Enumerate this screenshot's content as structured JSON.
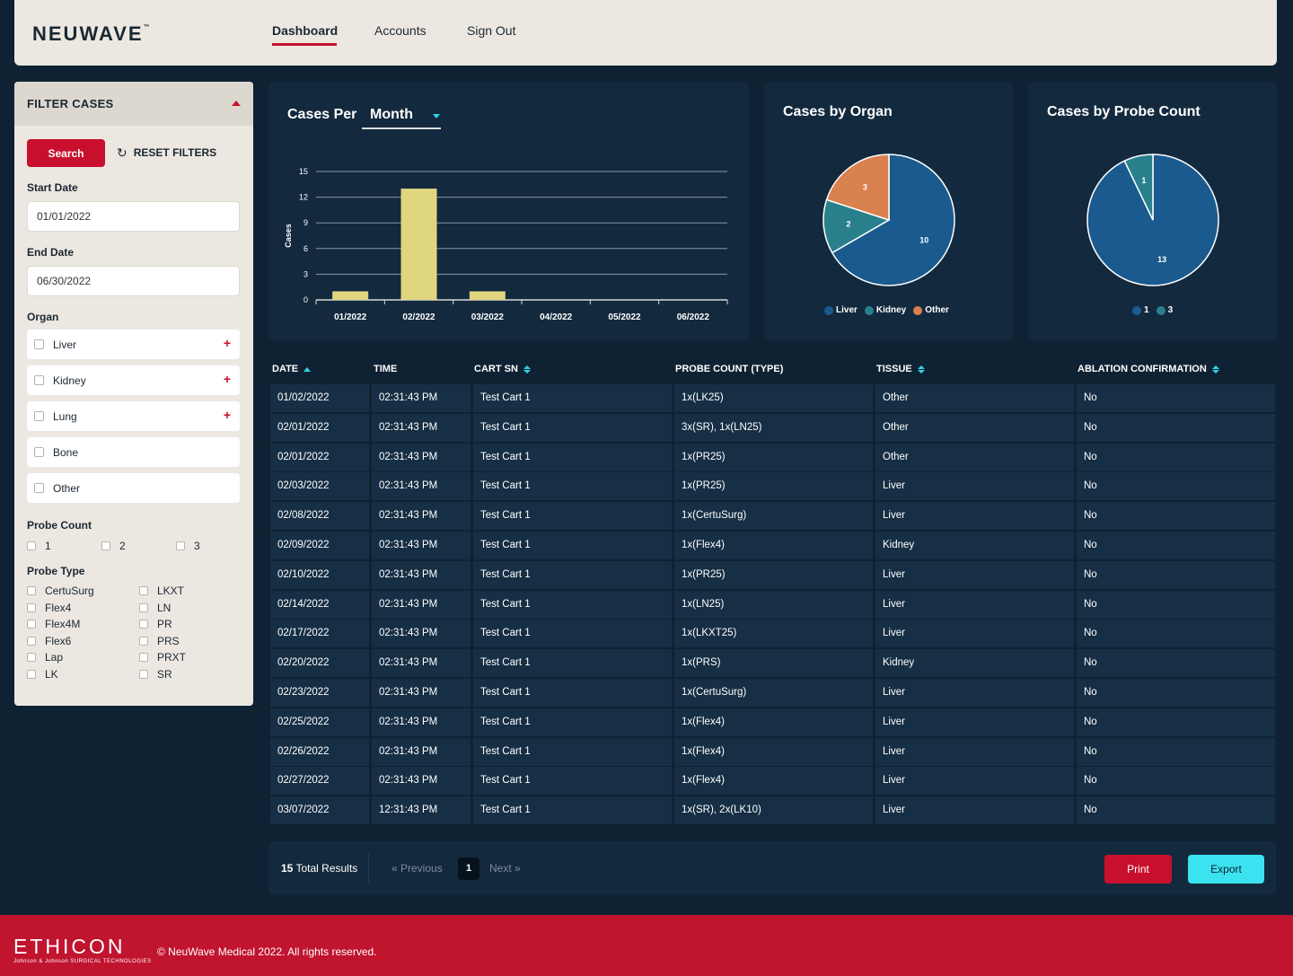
{
  "header": {
    "logo": "NEUWAVE",
    "logo_mark": "™",
    "nav": [
      "Dashboard",
      "Accounts",
      "Sign Out"
    ]
  },
  "sidebar": {
    "title": "FILTER CASES",
    "search_label": "Search",
    "reset_label": "RESET FILTERS",
    "start_date_label": "Start Date",
    "start_date_value": "01/01/2022",
    "end_date_label": "End Date",
    "end_date_value": "06/30/2022",
    "organ_label": "Organ",
    "organs": [
      "Liver",
      "Kidney",
      "Lung",
      "Bone",
      "Other"
    ],
    "probe_count_label": "Probe Count",
    "probe_counts": [
      "1",
      "2",
      "3"
    ],
    "probe_type_label": "Probe Type",
    "probe_types_left": [
      "CertuSurg",
      "Flex4",
      "Flex4M",
      "Flex6",
      "Lap",
      "LK"
    ],
    "probe_types_right": [
      "LKXT",
      "LN",
      "PR",
      "PRS",
      "PRXT",
      "SR"
    ]
  },
  "cases_chart": {
    "title": "Cases Per",
    "period": "Month"
  },
  "organ_chart": {
    "title": "Cases by Organ"
  },
  "probe_chart": {
    "title": "Cases by Probe Count"
  },
  "chart_data": [
    {
      "type": "bar",
      "title": "Cases Per Month",
      "categories": [
        "01/2022",
        "02/2022",
        "03/2022",
        "04/2022",
        "05/2022",
        "06/2022"
      ],
      "values": [
        1,
        13,
        1,
        0,
        0,
        0
      ],
      "ylabel": "Cases",
      "yticks": [
        0,
        3,
        6,
        9,
        12,
        15
      ],
      "ylim": [
        0,
        15
      ],
      "grid": true,
      "color": "#e0d67f"
    },
    {
      "type": "pie",
      "title": "Cases by Organ",
      "labels": [
        "Liver",
        "Kidney",
        "Other"
      ],
      "values": [
        10,
        2,
        3
      ],
      "colors": [
        "#1a5a8e",
        "#2a7f8d",
        "#d9814f"
      ],
      "legend": "bottom"
    },
    {
      "type": "pie",
      "title": "Cases by Probe Count",
      "labels": [
        "1",
        "3"
      ],
      "values": [
        13,
        1
      ],
      "colors": [
        "#1a5a8e",
        "#2a7f8d"
      ],
      "legend": "bottom"
    }
  ],
  "table": {
    "headers": [
      "DATE",
      "TIME",
      "CART SN",
      "PROBE COUNT (TYPE)",
      "TISSUE",
      "ABLATION CONFIRMATION"
    ],
    "rows": [
      [
        "01/02/2022",
        "02:31:43 PM",
        "Test Cart 1",
        "1x(LK25)",
        "Other",
        "No"
      ],
      [
        "02/01/2022",
        "02:31:43 PM",
        "Test Cart 1",
        "3x(SR), 1x(LN25)",
        "Other",
        "No"
      ],
      [
        "02/01/2022",
        "02:31:43 PM",
        "Test Cart 1",
        "1x(PR25)",
        "Other",
        "No"
      ],
      [
        "02/03/2022",
        "02:31:43 PM",
        "Test Cart 1",
        "1x(PR25)",
        "Liver",
        "No"
      ],
      [
        "02/08/2022",
        "02:31:43 PM",
        "Test Cart 1",
        "1x(CertuSurg)",
        "Liver",
        "No"
      ],
      [
        "02/09/2022",
        "02:31:43 PM",
        "Test Cart 1",
        "1x(Flex4)",
        "Kidney",
        "No"
      ],
      [
        "02/10/2022",
        "02:31:43 PM",
        "Test Cart 1",
        "1x(PR25)",
        "Liver",
        "No"
      ],
      [
        "02/14/2022",
        "02:31:43 PM",
        "Test Cart 1",
        "1x(LN25)",
        "Liver",
        "No"
      ],
      [
        "02/17/2022",
        "02:31:43 PM",
        "Test Cart 1",
        "1x(LKXT25)",
        "Liver",
        "No"
      ],
      [
        "02/20/2022",
        "02:31:43 PM",
        "Test Cart 1",
        "1x(PRS)",
        "Kidney",
        "No"
      ],
      [
        "02/23/2022",
        "02:31:43 PM",
        "Test Cart 1",
        "1x(CertuSurg)",
        "Liver",
        "No"
      ],
      [
        "02/25/2022",
        "02:31:43 PM",
        "Test Cart 1",
        "1x(Flex4)",
        "Liver",
        "No"
      ],
      [
        "02/26/2022",
        "02:31:43 PM",
        "Test Cart 1",
        "1x(Flex4)",
        "Liver",
        "No"
      ],
      [
        "02/27/2022",
        "02:31:43 PM",
        "Test Cart 1",
        "1x(Flex4)",
        "Liver",
        "No"
      ],
      [
        "03/07/2022",
        "12:31:43 PM",
        "Test Cart 1",
        "1x(SR), 2x(LK10)",
        "Liver",
        "No"
      ]
    ]
  },
  "pagination": {
    "total_count": "15",
    "total_label": "Total Results",
    "prev": "« Previous",
    "page": "1",
    "next": "Next »",
    "print": "Print",
    "export": "Export"
  },
  "footer": {
    "brand": "ETHICON",
    "brand_sub": "Johnson & Johnson SURGICAL TECHNOLOGIES",
    "copyright": "© NeuWave Medical 2022. All rights reserved."
  },
  "colors": {
    "accent_red": "#c8102e",
    "accent_cyan": "#3be3f0",
    "background": "#0f2233",
    "panel": "#13293d"
  }
}
